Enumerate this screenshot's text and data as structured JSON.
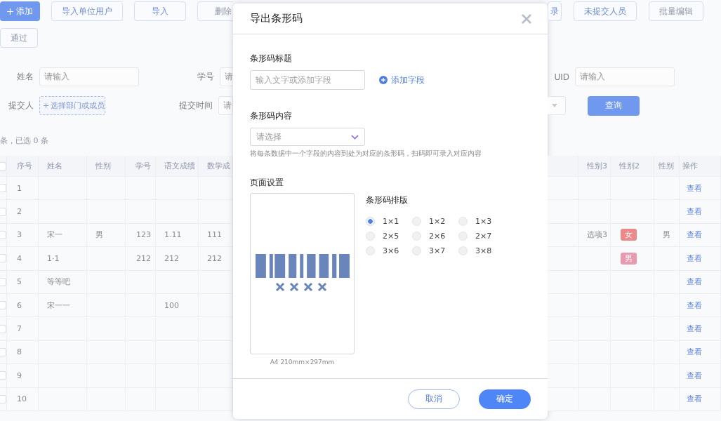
{
  "left_pane": {
    "toolbar": [
      {
        "label": "添加",
        "kind": "primary",
        "disabled": false
      },
      {
        "label": "导入单位用户",
        "kind": "default",
        "disabled": false
      },
      {
        "label": "导入",
        "kind": "default",
        "disabled": false
      },
      {
        "label": "删除",
        "kind": "default",
        "disabled": true
      }
    ],
    "toolbar_2": [
      {
        "label": "通过",
        "kind": "default",
        "disabled": true
      }
    ],
    "filters": [
      [
        {
          "label": "姓名",
          "kind": "input",
          "placeholder": "请输入"
        },
        {
          "label": "学号",
          "kind": "input",
          "placeholder": "请"
        }
      ],
      [
        {
          "label": "提交人",
          "kind": "picker",
          "placeholder": "选择部门或成员"
        },
        {
          "label": "提交时间",
          "kind": "input",
          "placeholder": "请"
        }
      ]
    ],
    "count": "条，已选 0 条",
    "table": {
      "header_checked": false,
      "columns": [
        "序号",
        "姓名",
        "性别",
        "学号",
        "语文成绩",
        "数学成"
      ],
      "rows": [
        {
          "checked": false,
          "cells": [
            "1",
            "",
            "",
            "",
            "",
            ""
          ]
        },
        {
          "checked": false,
          "cells": [
            "2",
            "",
            "",
            "",
            "",
            ""
          ]
        },
        {
          "checked": false,
          "cells": [
            "3",
            "宋一",
            "男",
            "123",
            "1.11",
            "111"
          ]
        },
        {
          "checked": false,
          "cells": [
            "4",
            "1·1",
            "",
            "212",
            "212",
            "212"
          ]
        },
        {
          "checked": false,
          "cells": [
            "5",
            "等等吧",
            "",
            "",
            "",
            ""
          ]
        },
        {
          "checked": false,
          "cells": [
            "6",
            "宋一一",
            "",
            "",
            "100",
            ""
          ]
        },
        {
          "checked": false,
          "cells": [
            "7",
            "",
            "",
            "",
            "",
            ""
          ]
        },
        {
          "checked": false,
          "cells": [
            "8",
            "",
            "",
            "",
            "",
            ""
          ]
        },
        {
          "checked": false,
          "cells": [
            "9",
            "",
            "",
            "",
            "",
            ""
          ]
        },
        {
          "checked": false,
          "cells": [
            "10",
            "",
            "",
            "",
            "",
            ""
          ]
        }
      ]
    }
  },
  "dialog": {
    "title": "导出条形码",
    "barcode_title": {
      "label": "条形码标题",
      "placeholder": "输入文字或添加字段",
      "add_field": "添加字段"
    },
    "barcode_content": {
      "label": "条形码内容",
      "placeholder": "请选择",
      "hint": "将每条数据中一个字段的内容到处为对应的条形码，扫码即可录入对应内容"
    },
    "page_setup": {
      "label": "页面设置",
      "paper": "A4 210mm×297mm",
      "layout_label": "条形码排版",
      "layouts": [
        {
          "label": "1×1",
          "selected": true
        },
        {
          "label": "1×2",
          "selected": false
        },
        {
          "label": "1×3",
          "selected": false
        },
        {
          "label": "2×5",
          "selected": false
        },
        {
          "label": "2×6",
          "selected": false
        },
        {
          "label": "2×7",
          "selected": false
        },
        {
          "label": "3×6",
          "selected": false
        },
        {
          "label": "3×7",
          "selected": false
        },
        {
          "label": "3×8",
          "selected": false
        }
      ]
    },
    "buttons": [
      {
        "label": "取消",
        "kind": "secondary"
      },
      {
        "label": "确定",
        "kind": "primary"
      }
    ]
  },
  "right_pane": {
    "toolbar": [
      {
        "label": "录",
        "kind": "default",
        "disabled": false
      },
      {
        "label": "未提交人员",
        "kind": "default",
        "disabled": false
      },
      {
        "label": "批量编辑",
        "kind": "default",
        "disabled": true
      }
    ],
    "filters": [
      {
        "label": "UID",
        "placeholder": "请输入"
      }
    ],
    "query_button": "查询",
    "table": {
      "columns": [
        "",
        "性别3",
        "性别2",
        "性别",
        "操作"
      ],
      "rows": [
        {
          "cells": [
            "",
            "",
            "",
            ""
          ],
          "tag": null,
          "action": "查看"
        },
        {
          "cells": [
            "",
            "",
            "",
            ""
          ],
          "tag": null,
          "action": "查看"
        },
        {
          "cells": [
            "",
            "选项3",
            "",
            "男"
          ],
          "tag": {
            "label": "女",
            "color": "#ec8a8a"
          },
          "action": "查看"
        },
        {
          "cells": [
            "",
            "",
            "",
            ""
          ],
          "tag": {
            "label": "男",
            "color": "#e89bb0"
          },
          "action": "查看"
        },
        {
          "cells": [
            "",
            "",
            "",
            ""
          ],
          "tag": null,
          "action": "查看"
        },
        {
          "cells": [
            "",
            "",
            "",
            ""
          ],
          "tag": null,
          "action": "查看"
        },
        {
          "cells": [
            "",
            "",
            "",
            ""
          ],
          "tag": null,
          "action": "查看"
        },
        {
          "cells": [
            "",
            "",
            "",
            ""
          ],
          "tag": null,
          "action": "查看"
        },
        {
          "cells": [
            "",
            "",
            "",
            ""
          ],
          "tag": null,
          "action": "查看"
        },
        {
          "cells": [
            "",
            "",
            "",
            ""
          ],
          "tag": null,
          "action": "查看"
        }
      ]
    }
  }
}
